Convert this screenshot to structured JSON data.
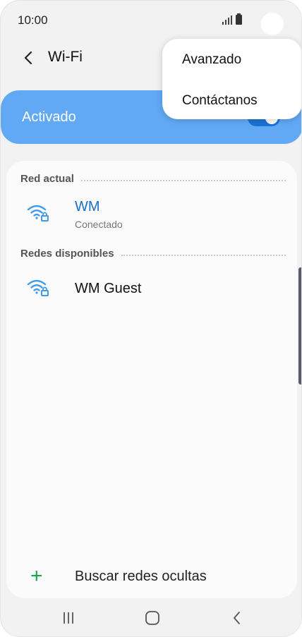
{
  "status_bar": {
    "time": "10:00"
  },
  "header": {
    "title": "Wi-Fi"
  },
  "wifi_toggle": {
    "label": "Activado",
    "state": "on"
  },
  "sections": {
    "current": {
      "title": "Red actual"
    },
    "available": {
      "title": "Redes disponibles"
    }
  },
  "current_network": {
    "name": "WM",
    "status": "Conectado"
  },
  "available_networks": [
    {
      "name": "WM Guest"
    }
  ],
  "add_network": {
    "label": "Buscar redes ocultas"
  },
  "overflow_menu": {
    "items": [
      "Avanzado",
      "Contáctanos"
    ]
  },
  "colors": {
    "accent_blue": "#62a9f5",
    "connected_text": "#1a6fc9",
    "wifi_icon": "#3d9be9",
    "plus_green": "#1ba84a"
  },
  "icons": {
    "back": "back-arrow-icon",
    "wifi_locked": "wifi-lock-icon",
    "add": "plus-icon",
    "nav_recents": "recents-icon",
    "nav_home": "home-icon",
    "nav_back": "nav-back-icon"
  }
}
